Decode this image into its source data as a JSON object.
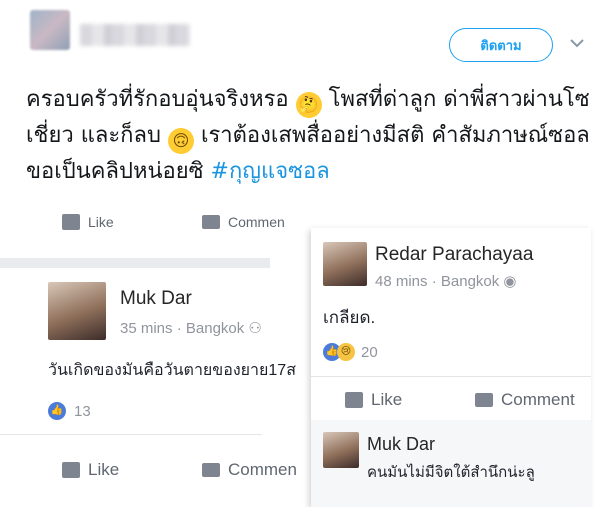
{
  "tweet": {
    "follow_label": "ติดตาม",
    "text_part1": "ครอบครัวที่รักอบอุ่นจริงหรอ",
    "text_part2": "โพสที่ด่าลูก ด่าพี่สาวผ่านโซเชี่ยว และก็ลบ",
    "text_part3": "เราต้องเสพสื่ออย่างมีสติ คำสัมภาษณ์ซอลขอเป็นคลิปหน่อยซิ",
    "hashtag": "#กุญแจซอล",
    "emoji1": "🤔",
    "emoji2": "🙃"
  },
  "fb_top_partial": {
    "like_label": "Like",
    "comment_label": "Commen"
  },
  "post_left": {
    "author": "Muk Dar",
    "time": "35 mins",
    "location": "Bangkok",
    "text": "วันเกิดของมันคือวันตายของยาย17ส",
    "reactions": "13",
    "like_label": "Like",
    "comment_label": "Commen"
  },
  "post_right": {
    "author": "Redar Parachayaa",
    "time": "48 mins",
    "location": "Bangkok",
    "text": "เกลียด.",
    "reactions": "20",
    "like_label": "Like",
    "comment_label": "Comment",
    "reply_author": "Muk Dar",
    "reply_text": "คนมันไม่มีจิตใต้สำนึกน่ะลู"
  },
  "colors": {
    "twitter_blue": "#1da1f2",
    "hashtag": "#1b95e0",
    "fb_meta": "#90949c",
    "fb_separator": "#e9ebee"
  }
}
